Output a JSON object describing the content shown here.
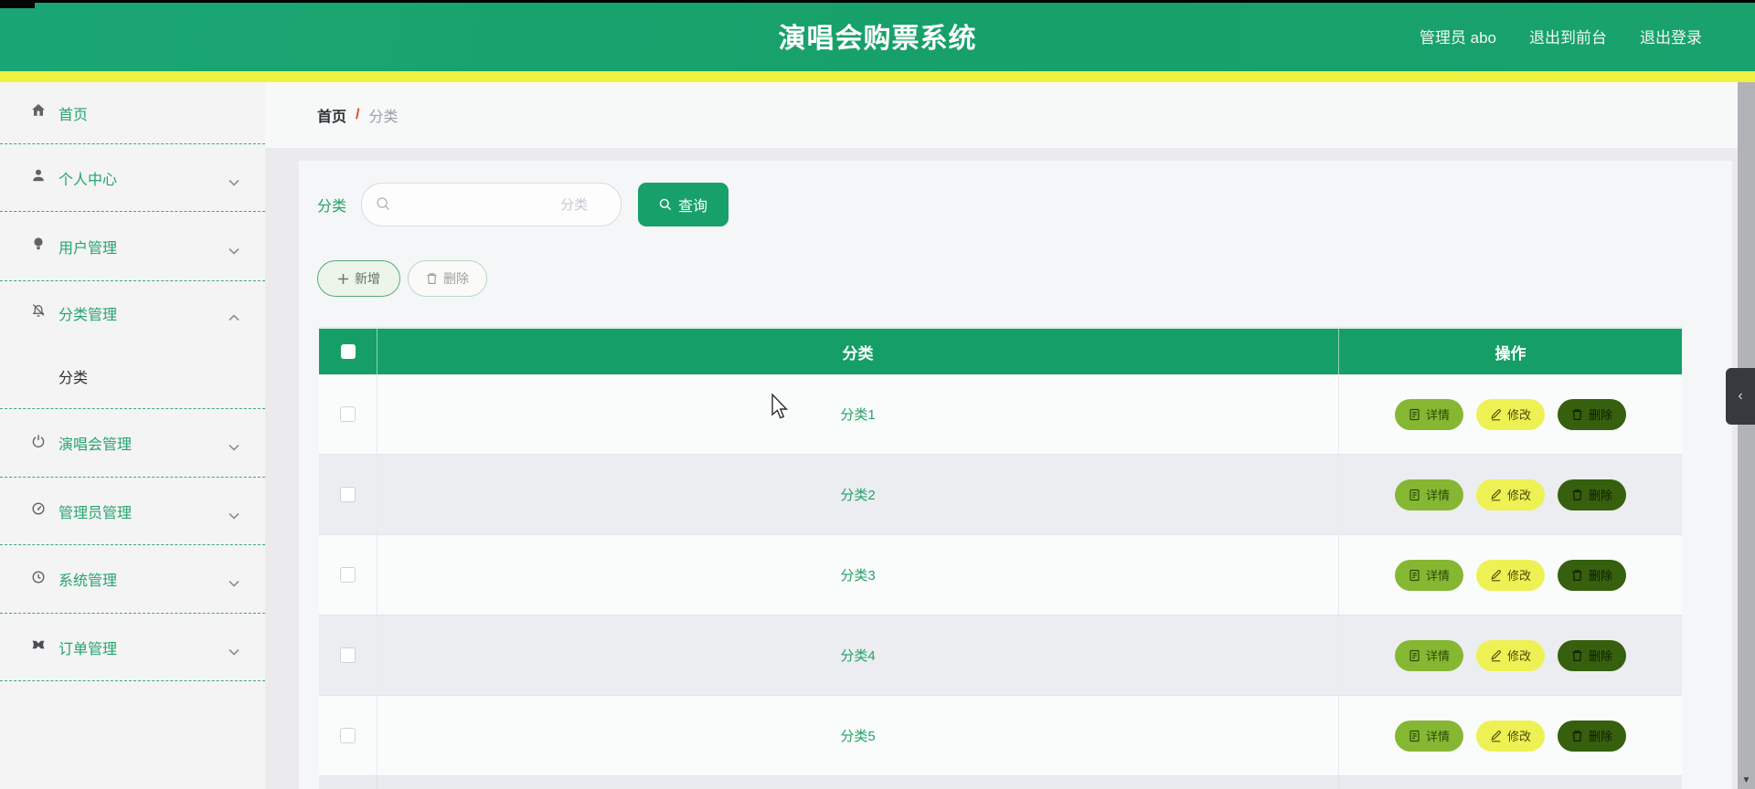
{
  "app": {
    "title": "演唱会购票系统"
  },
  "header": {
    "admin_label": "管理员 abo",
    "exit_to_front": "退出到前台",
    "logout": "退出登录"
  },
  "sidebar": {
    "items": [
      {
        "label": "首页",
        "icon": "home-icon",
        "expandable": false
      },
      {
        "label": "个人中心",
        "icon": "profile-icon",
        "expandable": true,
        "expanded": false
      },
      {
        "label": "用户管理",
        "icon": "users-icon",
        "expandable": true,
        "expanded": false
      },
      {
        "label": "分类管理",
        "icon": "category-icon",
        "expandable": true,
        "expanded": true
      },
      {
        "label": "分类",
        "icon": null,
        "submenu": true,
        "active": true
      },
      {
        "label": "演唱会管理",
        "icon": "concert-icon",
        "expandable": true,
        "expanded": false
      },
      {
        "label": "管理员管理",
        "icon": "admin-icon",
        "expandable": true,
        "expanded": false
      },
      {
        "label": "系统管理",
        "icon": "system-icon",
        "expandable": true,
        "expanded": false
      },
      {
        "label": "订单管理",
        "icon": "orders-icon",
        "expandable": true,
        "expanded": false
      }
    ]
  },
  "breadcrumb": {
    "root": "首页",
    "separator": "/",
    "current": "分类"
  },
  "search": {
    "label": "分类",
    "placeholder": "分类",
    "query_button": "查询"
  },
  "toolbar": {
    "add_button": "新增",
    "delete_button": "删除"
  },
  "table": {
    "header": {
      "category": "分类",
      "actions": "操作"
    },
    "rows": [
      {
        "category": "分类1"
      },
      {
        "category": "分类2"
      },
      {
        "category": "分类3"
      },
      {
        "category": "分类4"
      },
      {
        "category": "分类5"
      }
    ],
    "row_actions": {
      "detail": "详情",
      "edit": "修改",
      "delete": "删除"
    }
  },
  "panel_toggle": {
    "collapse_icon": "‹"
  },
  "colors": {
    "header_green": "#17A069",
    "strip_yellow": "#EEF23F",
    "table_header_green": "#169E67",
    "link_green": "#21A366",
    "sidebar_divider_green": "#3EA87B",
    "detail_button": "#85B733",
    "edit_button": "#EEF153",
    "delete_button": "#365F0E",
    "breadcrumb_separator_red": "#E0482E"
  }
}
